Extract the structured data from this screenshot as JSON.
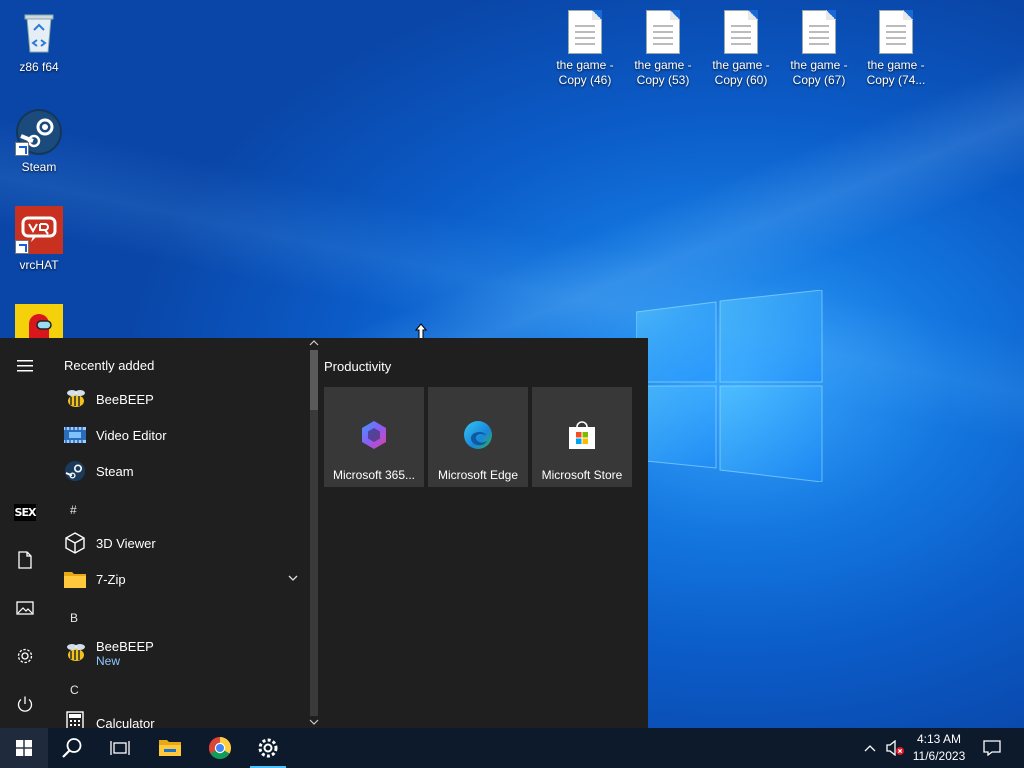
{
  "desktop": {
    "icons": [
      {
        "label": "z86 f64",
        "icon": "recycle-bin-icon"
      },
      {
        "label": "Steam",
        "icon": "steam-icon"
      },
      {
        "label": "vrcHAT",
        "icon": "vrchat-icon"
      },
      {
        "label": "",
        "icon": "among-us-icon"
      }
    ],
    "files": [
      {
        "line1": "the game -",
        "line2": "Copy (46)"
      },
      {
        "line1": "the game -",
        "line2": "Copy (53)"
      },
      {
        "line1": "the game -",
        "line2": "Copy (60)"
      },
      {
        "line1": "the game -",
        "line2": "Copy (67)"
      },
      {
        "line1": "the game -",
        "line2": "Copy (74..."
      }
    ]
  },
  "start_menu": {
    "rail": {
      "user_initials": "SEX",
      "items": [
        "menu-icon",
        "user-icon",
        "documents-icon",
        "pictures-icon",
        "settings-icon",
        "power-icon"
      ]
    },
    "recently_added_header": "Recently added",
    "recent": [
      {
        "name": "BeeBEEP"
      },
      {
        "name": "Video Editor"
      },
      {
        "name": "Steam"
      }
    ],
    "sections": [
      {
        "letter": "#"
      },
      {
        "letter": "B"
      },
      {
        "letter": "C"
      }
    ],
    "apps": {
      "viewer3d": "3D Viewer",
      "zip": "7-Zip",
      "beebeep": "BeeBEEP",
      "beebeep_badge": "New",
      "calculator": "Calculator"
    },
    "tiles_group": "Productivity",
    "tiles": [
      {
        "label": "Microsoft 365...",
        "icon": "microsoft-365-icon"
      },
      {
        "label": "Microsoft Edge",
        "icon": "edge-icon"
      },
      {
        "label": "Microsoft Store",
        "icon": "store-icon"
      }
    ]
  },
  "taskbar": {
    "pinned": [
      "start-icon",
      "search-icon",
      "task-view-icon",
      "file-explorer-icon",
      "chrome-icon",
      "settings-icon"
    ],
    "time": "4:13 AM",
    "date": "11/6/2023"
  },
  "colors": {
    "start_bg": "#1f1f1f",
    "tile_bg": "#383838",
    "taskbar_bg": "#0d1a2c",
    "accent": "#4cc2ff"
  }
}
